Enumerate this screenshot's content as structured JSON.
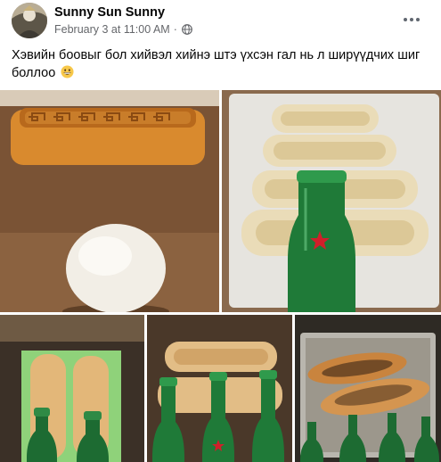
{
  "post": {
    "author": "Sunny Sun Sunny",
    "timestamp": "February 3 at 11:00 AM",
    "separator": "·",
    "privacy_icon": "globe-icon",
    "menu_icon": "more-horizontal-icon",
    "caption": "Хэвийн боовыг бол хийвэл хийнэ штэ үхсэн гал нь л ширүүдчих шиг боллоо",
    "caption_emoji": "grinning-face-emoji"
  },
  "photos": [
    {
      "name": "photo-wooden-mold-and-dough",
      "icon": "photo"
    },
    {
      "name": "photo-shaped-dough-in-tray",
      "icon": "photo"
    },
    {
      "name": "photo-dough-on-board",
      "icon": "photo"
    },
    {
      "name": "photo-baking-with-bottles",
      "icon": "photo"
    },
    {
      "name": "photo-baked-pastry",
      "icon": "photo"
    }
  ],
  "colors": {
    "text_primary": "#050505",
    "text_secondary": "#65676b",
    "background": "#ffffff"
  }
}
